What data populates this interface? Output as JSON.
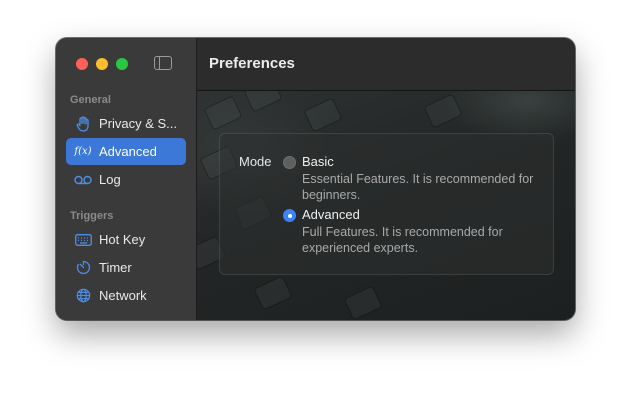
{
  "window": {
    "title": "Preferences"
  },
  "sidebar": {
    "sections": [
      {
        "label": "General",
        "items": [
          {
            "label": "Privacy & Security",
            "display_label": "Privacy & S...",
            "icon": "hand-icon",
            "selected": false
          },
          {
            "label": "Advanced",
            "icon": "function-icon",
            "icon_text": "f(x)",
            "selected": true
          },
          {
            "label": "Log",
            "icon": "voicemail-icon",
            "selected": false
          }
        ]
      },
      {
        "label": "Triggers",
        "items": [
          {
            "label": "Hot Key",
            "icon": "keyboard-icon",
            "selected": false
          },
          {
            "label": "Timer",
            "icon": "timer-icon",
            "selected": false
          },
          {
            "label": "Network",
            "icon": "globe-icon",
            "selected": false
          }
        ]
      }
    ]
  },
  "preferences": {
    "mode_label": "Mode",
    "options": [
      {
        "label": "Basic",
        "description": "Essential Features. It is recommended for beginners.",
        "selected": false
      },
      {
        "label": "Advanced",
        "description": "Full Features. It is recommended for experienced experts.",
        "selected": true
      }
    ]
  },
  "colors": {
    "accent": "#3b78d8",
    "icon_blue": "#4d8fe8",
    "close": "#ff5f57",
    "minimize": "#febc2e",
    "maximize": "#28c840"
  }
}
